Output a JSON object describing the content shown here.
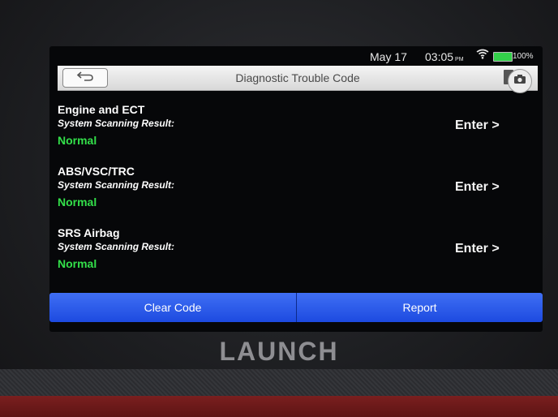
{
  "statusbar": {
    "date": "May 17",
    "time": "03:05",
    "ampm": "PM",
    "battery": "100%",
    "battery_level": 1.0
  },
  "titlebar": {
    "title": "Diagnostic Trouble Code"
  },
  "systems": [
    {
      "name": "Engine and ECT",
      "label": "System Scanning Result:",
      "status": "Normal",
      "action": "Enter >"
    },
    {
      "name": "ABS/VSC/TRC",
      "label": "System Scanning Result:",
      "status": "Normal",
      "action": "Enter >"
    },
    {
      "name": "SRS Airbag",
      "label": "System Scanning Result:",
      "status": "Normal",
      "action": "Enter >"
    }
  ],
  "buttons": {
    "clear": "Clear Code",
    "report": "Report"
  },
  "brand": {
    "logo": "LAUNCH"
  },
  "colors": {
    "accent": "#2654e8",
    "status_ok": "#33e04a",
    "titlebar": "#e6e6e6"
  },
  "icons": {
    "back": "back-arrow-icon",
    "camera": "camera-icon",
    "wifi": "wifi-icon",
    "battery": "battery-icon"
  }
}
